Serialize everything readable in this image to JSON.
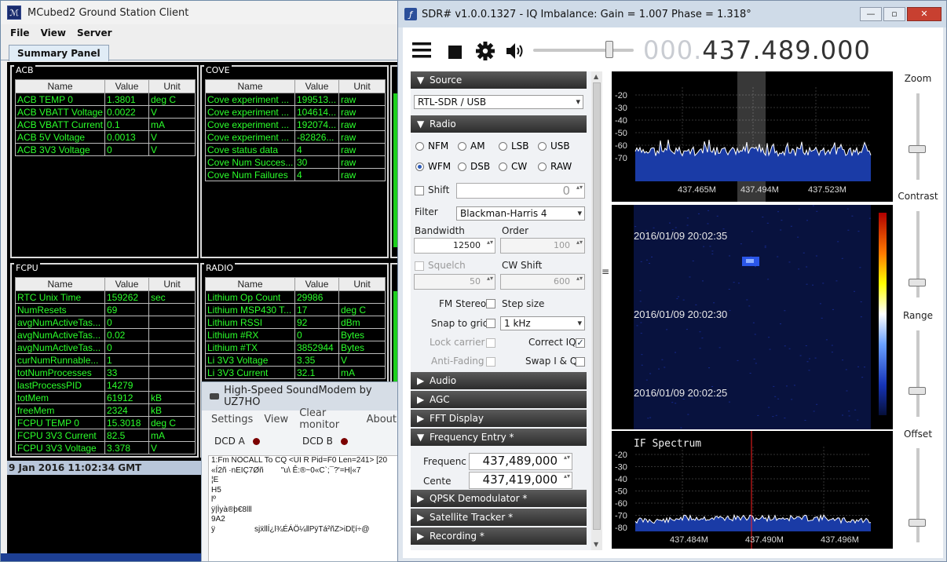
{
  "mcubed": {
    "title": "MCubed2 Ground Station Client",
    "menu": [
      "File",
      "View",
      "Server"
    ],
    "tab": "Summary Panel",
    "columns": [
      "Name",
      "Value",
      "Unit"
    ],
    "acb": {
      "label": "ACB",
      "rows": [
        [
          "ACB TEMP 0",
          "1.3801",
          "deg C"
        ],
        [
          "ACB VBATT Voltage",
          "0.0022",
          "V"
        ],
        [
          "ACB VBATT Current",
          "0.1",
          "mA"
        ],
        [
          "ACB 5V Voltage",
          "0.0013",
          "V"
        ],
        [
          "ACB 3V3 Voltage",
          "0",
          "V"
        ]
      ]
    },
    "cove": {
      "label": "COVE",
      "rows": [
        [
          "Cove experiment ...",
          "199513...",
          "raw"
        ],
        [
          "Cove experiment ...",
          "104614...",
          "raw"
        ],
        [
          "Cove experiment ...",
          "192074...",
          "raw"
        ],
        [
          "Cove experiment ...",
          "-82826...",
          "raw"
        ],
        [
          "Cove status data",
          "4",
          "raw"
        ],
        [
          "Cove Num Succes...",
          "30",
          "raw"
        ],
        [
          "Cove Num Failures",
          "4",
          "raw"
        ]
      ]
    },
    "fcpu": {
      "label": "FCPU",
      "rows": [
        [
          "RTC Unix Time",
          "159262",
          "sec"
        ],
        [
          "NumResets",
          "69",
          ""
        ],
        [
          "avgNumActiveTas...",
          "0",
          ""
        ],
        [
          "avgNumActiveTas...",
          "0.02",
          ""
        ],
        [
          "avgNumActiveTas...",
          "0",
          ""
        ],
        [
          "curNumRunnable...",
          "1",
          ""
        ],
        [
          "totNumProcesses",
          "33",
          ""
        ],
        [
          "lastProcessPID",
          "14279",
          ""
        ],
        [
          "totMem",
          "61912",
          "kB"
        ],
        [
          "freeMem",
          "2324",
          "kB"
        ],
        [
          "FCPU TEMP 0",
          "15.3018",
          "deg C"
        ],
        [
          "FCPU 3V3 Current",
          "82.5",
          "mA"
        ],
        [
          "FCPU 3V3 Voltage",
          "3.378",
          "V"
        ]
      ]
    },
    "radio": {
      "label": "RADIO",
      "rows": [
        [
          "Lithium Op Count",
          "29986",
          ""
        ],
        [
          "Lithium MSP430 T...",
          "17",
          "deg C"
        ],
        [
          "Lithium RSSI",
          "92",
          "dBm"
        ],
        [
          "Lithium #RX",
          "0",
          "Bytes"
        ],
        [
          "Lithium #TX",
          "3852944",
          "Bytes"
        ],
        [
          "Li 3V3 Voltage",
          "3.35",
          "V"
        ],
        [
          "Li 3V3 Current",
          "32.1",
          "mA"
        ]
      ]
    },
    "status": "9 Jan 2016 11:02:34 GMT"
  },
  "soundmodem": {
    "title": "High-Speed SoundModem by UZ7HO",
    "menu": [
      "Settings",
      "View",
      "Clear monitor",
      "About"
    ],
    "dcd_a": "DCD A",
    "dcd_b": "DCD B",
    "monitor": "1:Fm NOCALL To CQ <UI R Pid=F0 Len=241> [20\n«Í2ñ ·nEIÇ7Øñ        \"u\\ Ê:®~0«C`;¯?'=H|«7\n¦E\nH5\nlº\nÿ|Ìyà®þ€8lll\n9A2\nÿ                  sjẍllÍ¿l¾ÉÁÖ¼‖PÿTá²ñZ>iDl¦í÷@"
  },
  "sdr": {
    "title": "SDR# v1.0.0.1327 - IQ Imbalance: Gain = 1.007 Phase = 1.318°",
    "freq_dim": "000.",
    "freq_main": "437.489.000",
    "sections": {
      "source": "Source",
      "radio": "Radio",
      "audio": "Audio",
      "agc": "AGC",
      "fft": "FFT Display",
      "freqentry": "Frequency Entry *",
      "qpsk": "QPSK Demodulator *",
      "sat": "Satellite Tracker *",
      "rec": "Recording *"
    },
    "source_device": "RTL-SDR / USB",
    "modes": [
      "NFM",
      "AM",
      "LSB",
      "USB",
      "WFM",
      "DSB",
      "CW",
      "RAW"
    ],
    "selected_mode": "WFM",
    "shift_label": "Shift",
    "shift_value": "0",
    "filter_label": "Filter",
    "filter_value": "Blackman-Harris 4",
    "bandwidth_label": "Bandwidth",
    "bandwidth_value": "12500",
    "order_label": "Order",
    "order_value": "100",
    "squelch_label": "Squelch",
    "squelch_value": "50",
    "cwshift_label": "CW Shift",
    "cwshift_value": "600",
    "fmstereo_label": "FM Stereo",
    "stepsize_label": "Step size",
    "snap_label": "Snap to grid",
    "step_value": "1 kHz",
    "lockcarrier_label": "Lock carrier",
    "correctiq_label": "Correct IQ",
    "antifading_label": "Anti-Fading",
    "swapiq_label": "Swap I & Q",
    "fe_freq_label": "Frequenc",
    "fe_freq_value": "437,489,000",
    "fe_center_label": "Cente",
    "fe_center_value": "437,419,000",
    "spectrum_top": {
      "y_ticks": [
        "-20",
        "-30",
        "-40",
        "-50",
        "-60",
        "-70"
      ],
      "x_ticks": [
        "437.465M",
        "437.494M",
        "437.523M"
      ]
    },
    "waterfall_times": [
      "2016/01/09 20:02:35",
      "2016/01/09 20:02:30",
      "2016/01/09 20:02:25"
    ],
    "if_spectrum": {
      "title": "IF Spectrum",
      "y_ticks": [
        "-20",
        "-30",
        "-40",
        "-50",
        "-60",
        "-70",
        "-80"
      ],
      "x_ticks": [
        "437.484M",
        "437.490M",
        "437.496M"
      ]
    },
    "right_labels": {
      "zoom": "Zoom",
      "contrast": "Contrast",
      "range": "Range",
      "offset": "Offset"
    },
    "colors": {
      "trace": "#ffffff",
      "fill": "#1a3ba6",
      "marker": "#ff2020",
      "tableText": "#2bff2b"
    }
  }
}
